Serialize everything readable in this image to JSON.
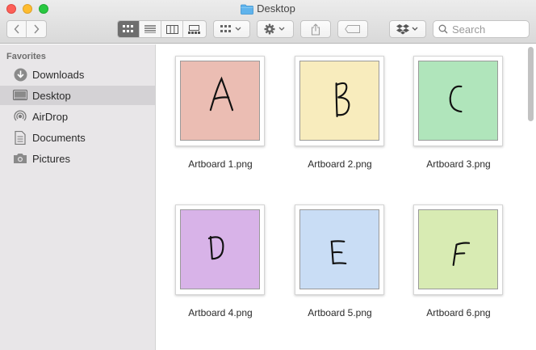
{
  "window": {
    "title": "Desktop"
  },
  "toolbar": {
    "search_placeholder": "Search"
  },
  "sidebar": {
    "header": "Favorites",
    "items": [
      {
        "label": "Downloads",
        "icon": "download-icon",
        "selected": false
      },
      {
        "label": "Desktop",
        "icon": "desktop-icon",
        "selected": true
      },
      {
        "label": "AirDrop",
        "icon": "airdrop-icon",
        "selected": false
      },
      {
        "label": "Documents",
        "icon": "documents-icon",
        "selected": false
      },
      {
        "label": "Pictures",
        "icon": "camera-icon",
        "selected": false
      }
    ]
  },
  "files": [
    {
      "name": "Artboard 1.png",
      "letter": "A",
      "color": "#ebbdb3"
    },
    {
      "name": "Artboard 2.png",
      "letter": "B",
      "color": "#f8ecbd"
    },
    {
      "name": "Artboard 3.png",
      "letter": "C",
      "color": "#b0e5bb"
    },
    {
      "name": "Artboard 4.png",
      "letter": "D",
      "color": "#d8b3e8"
    },
    {
      "name": "Artboard 5.png",
      "letter": "E",
      "color": "#c9ddf5"
    },
    {
      "name": "Artboard 6.png",
      "letter": "F",
      "color": "#d8ebb3"
    }
  ]
}
